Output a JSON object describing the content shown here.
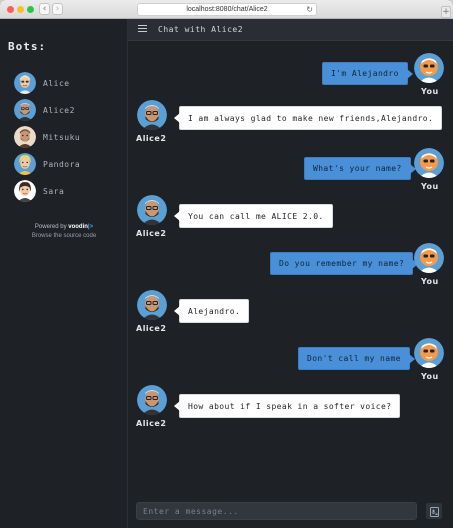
{
  "browser": {
    "url": "localhost:8080/chat/Alice2",
    "back_glyph": "‹",
    "forward_glyph": "›",
    "reload_glyph": "↻",
    "new_tab_glyph": "+"
  },
  "sidebar": {
    "title": "Bots:",
    "bots": [
      {
        "name": "Alice",
        "avatar": "alice-avatar"
      },
      {
        "name": "Alice2",
        "avatar": "alice2-avatar"
      },
      {
        "name": "Mitsuku",
        "avatar": "mitsuku-avatar"
      },
      {
        "name": "Pandora",
        "avatar": "pandora-avatar"
      },
      {
        "name": "Sara",
        "avatar": "sara-avatar"
      }
    ],
    "powered_by_prefix": "Powered by",
    "powered_by_brand": "voodin",
    "powered_by_brand_suffix": "|>",
    "source_link": "Browse the source code"
  },
  "header": {
    "title": "Chat with Alice2",
    "menu_icon": "hamburger-menu-icon"
  },
  "messages": [
    {
      "from": "user",
      "sender_label": "You",
      "text": "I'm Alejandro"
    },
    {
      "from": "bot",
      "sender_label": "Alice2",
      "lines": [
        "I am always glad to make new friends,",
        "Alejandro."
      ]
    },
    {
      "from": "user",
      "sender_label": "You",
      "text": "What's your name?"
    },
    {
      "from": "bot",
      "sender_label": "Alice2",
      "lines": [
        "You can call me ALICE 2.0."
      ]
    },
    {
      "from": "user",
      "sender_label": "You",
      "text": "Do you remember my name?"
    },
    {
      "from": "bot",
      "sender_label": "Alice2",
      "lines": [
        "Alejandro."
      ]
    },
    {
      "from": "user",
      "sender_label": "You",
      "text": "Don't call my name"
    },
    {
      "from": "bot",
      "sender_label": "Alice2",
      "lines": [
        "How about if I speak in a softer voice?"
      ]
    }
  ],
  "composer": {
    "placeholder": "Enter a message...",
    "voice_icon": "microphone-icon"
  },
  "colors": {
    "user_bubble": "#4a90d9",
    "bot_bubble": "#ffffff",
    "background": "#1e2126",
    "user_avatar_face": "#f49a4c",
    "bot_avatar_bg": "#5a9fd6"
  }
}
